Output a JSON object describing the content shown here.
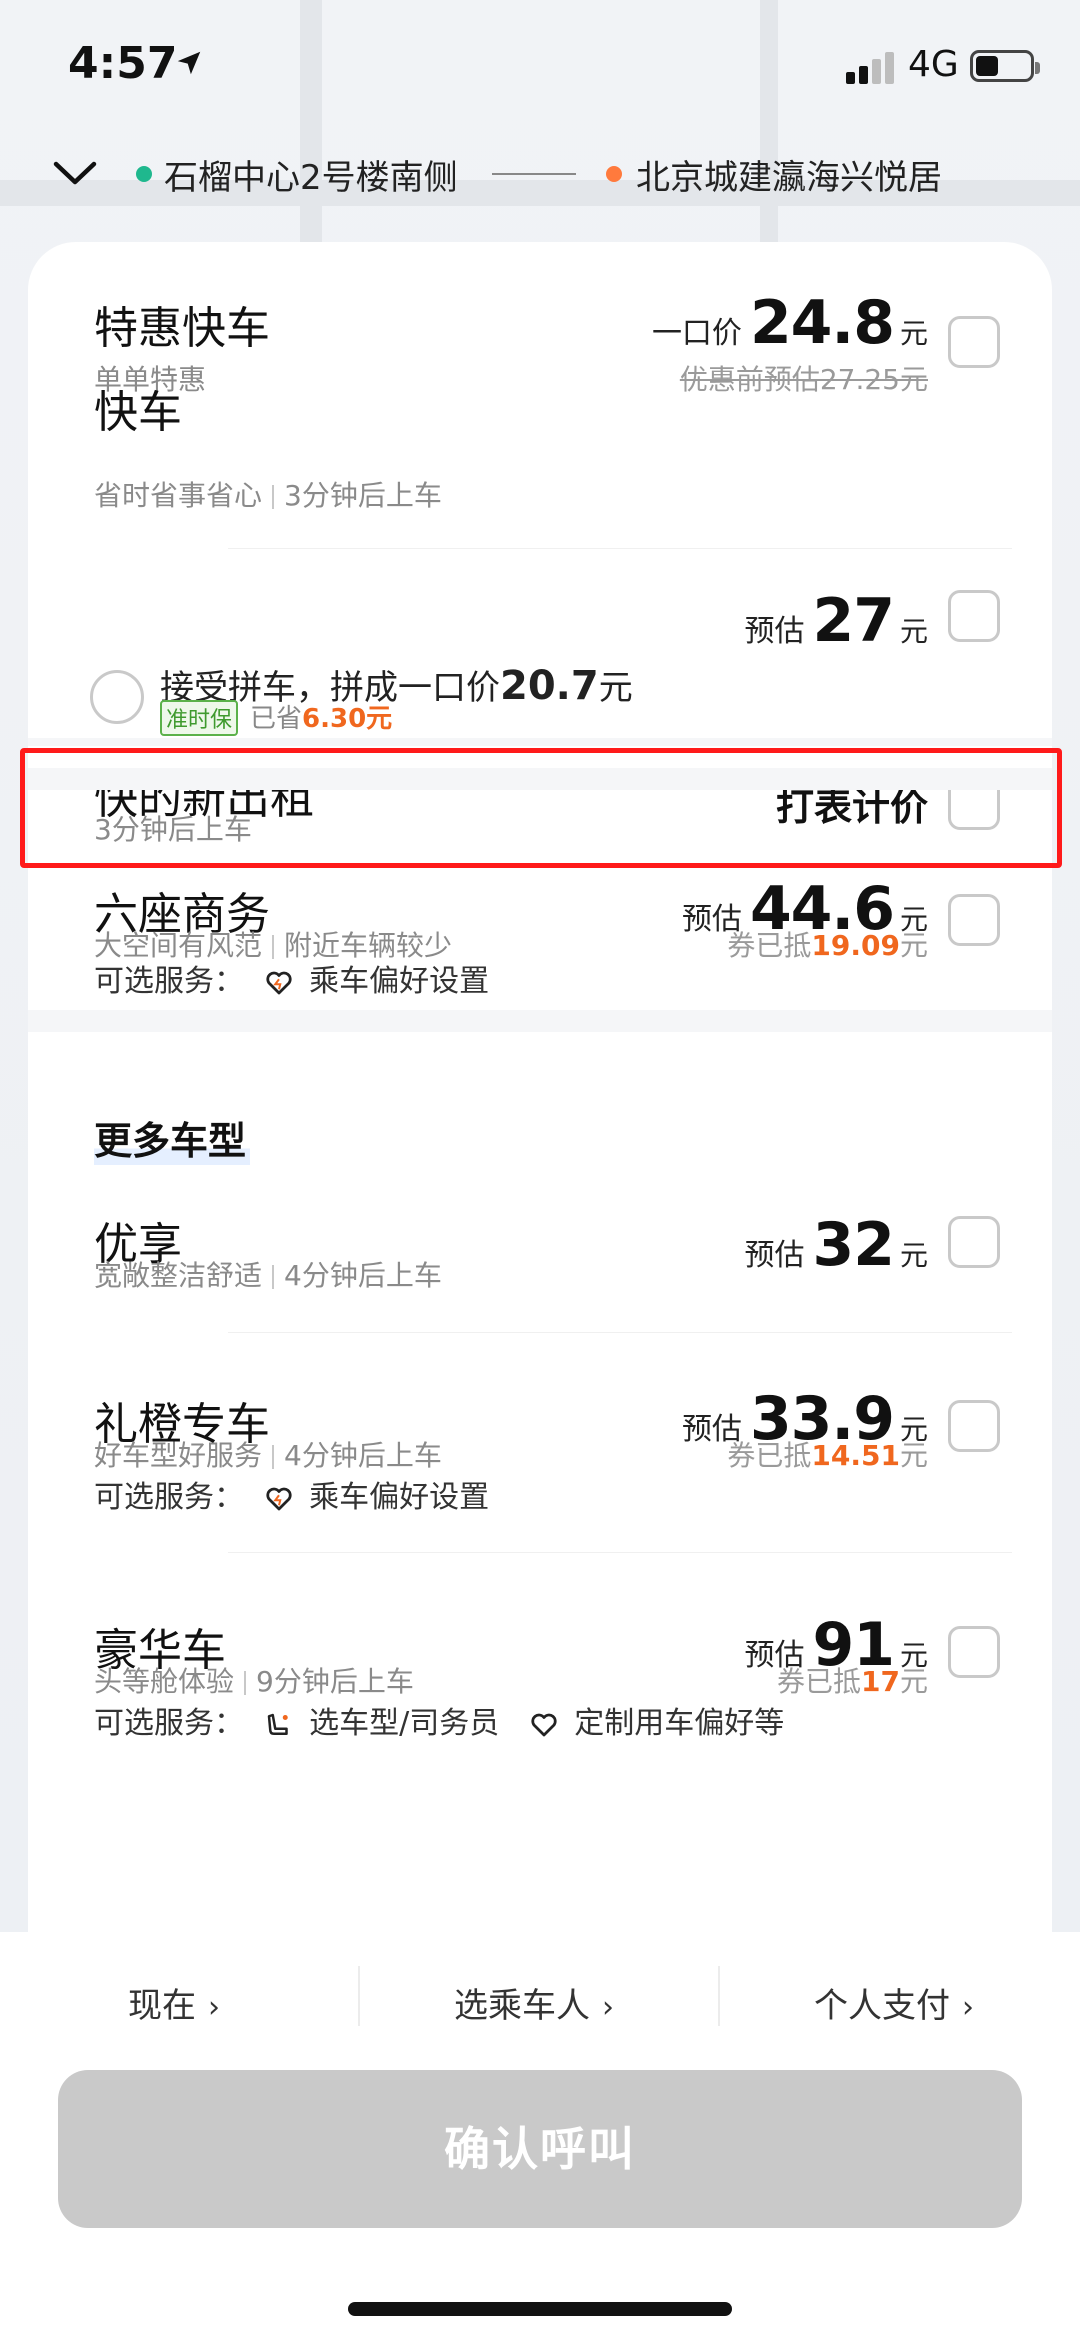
{
  "status_bar": {
    "time": "4:57",
    "network": "4G"
  },
  "route": {
    "from": "石榴中心2号楼南侧",
    "to": "北京城建瀛海兴悦居",
    "from_color": "#1fb88e",
    "to_color": "#ff7a3d"
  },
  "rides": [
    {
      "title": "特惠快车",
      "sub": [
        "单单特惠"
      ],
      "price_label": "一口价",
      "price": "24.8",
      "unit": "元",
      "note": "优惠前预估27.25元"
    },
    {
      "title": "快车",
      "sub": [
        "省时省事省心",
        "3分钟后上车"
      ],
      "price_label": "预估",
      "price": "27",
      "unit": "元",
      "pool": {
        "text": "接受拼车，拼成一口价",
        "price": "20.7",
        "unit": "元",
        "badge": "准时保",
        "saved_label": "已省",
        "saved": "6.30元"
      }
    },
    {
      "title": "快的新出租",
      "sub": [
        "3分钟后上车"
      ],
      "meter": "打表计价"
    },
    {
      "title": "六座商务",
      "sub": [
        "大空间有风范",
        "附近车辆较少"
      ],
      "price_label": "预估",
      "price": "44.6",
      "unit": "元",
      "note_prefix": "券已抵",
      "note_value": "19.09",
      "note_suffix": "元",
      "services_label": "可选服务：",
      "services": [
        "乘车偏好设置"
      ]
    }
  ],
  "more_title": "更多车型",
  "more_rides": [
    {
      "title": "优享",
      "sub": [
        "宽敞整洁舒适",
        "4分钟后上车"
      ],
      "price_label": "预估",
      "price": "32",
      "unit": "元"
    },
    {
      "title": "礼橙专车",
      "sub": [
        "好车型好服务",
        "4分钟后上车"
      ],
      "price_label": "预估",
      "price": "33.9",
      "unit": "元",
      "note_prefix": "券已抵",
      "note_value": "14.51",
      "note_suffix": "元",
      "services_label": "可选服务：",
      "services": [
        "乘车偏好设置"
      ]
    },
    {
      "title": "豪华车",
      "sub": [
        "头等舱体验",
        "9分钟后上车"
      ],
      "price_label": "预估",
      "price": "91",
      "unit": "元",
      "note_prefix": "券已抵",
      "note_value": "17",
      "note_suffix": "元",
      "services_label": "可选服务：",
      "services": [
        "选车型/司务员",
        "定制用车偏好等"
      ]
    }
  ],
  "bottom": {
    "options": [
      "现在",
      "选乘车人",
      "个人支付"
    ],
    "confirm": "确认呼叫"
  },
  "colors": {
    "accent_orange": "#f0671e",
    "highlight": "#ff1a1a",
    "badge_green": "#3f9a2e",
    "confirm_disabled": "#c9c9c9"
  }
}
